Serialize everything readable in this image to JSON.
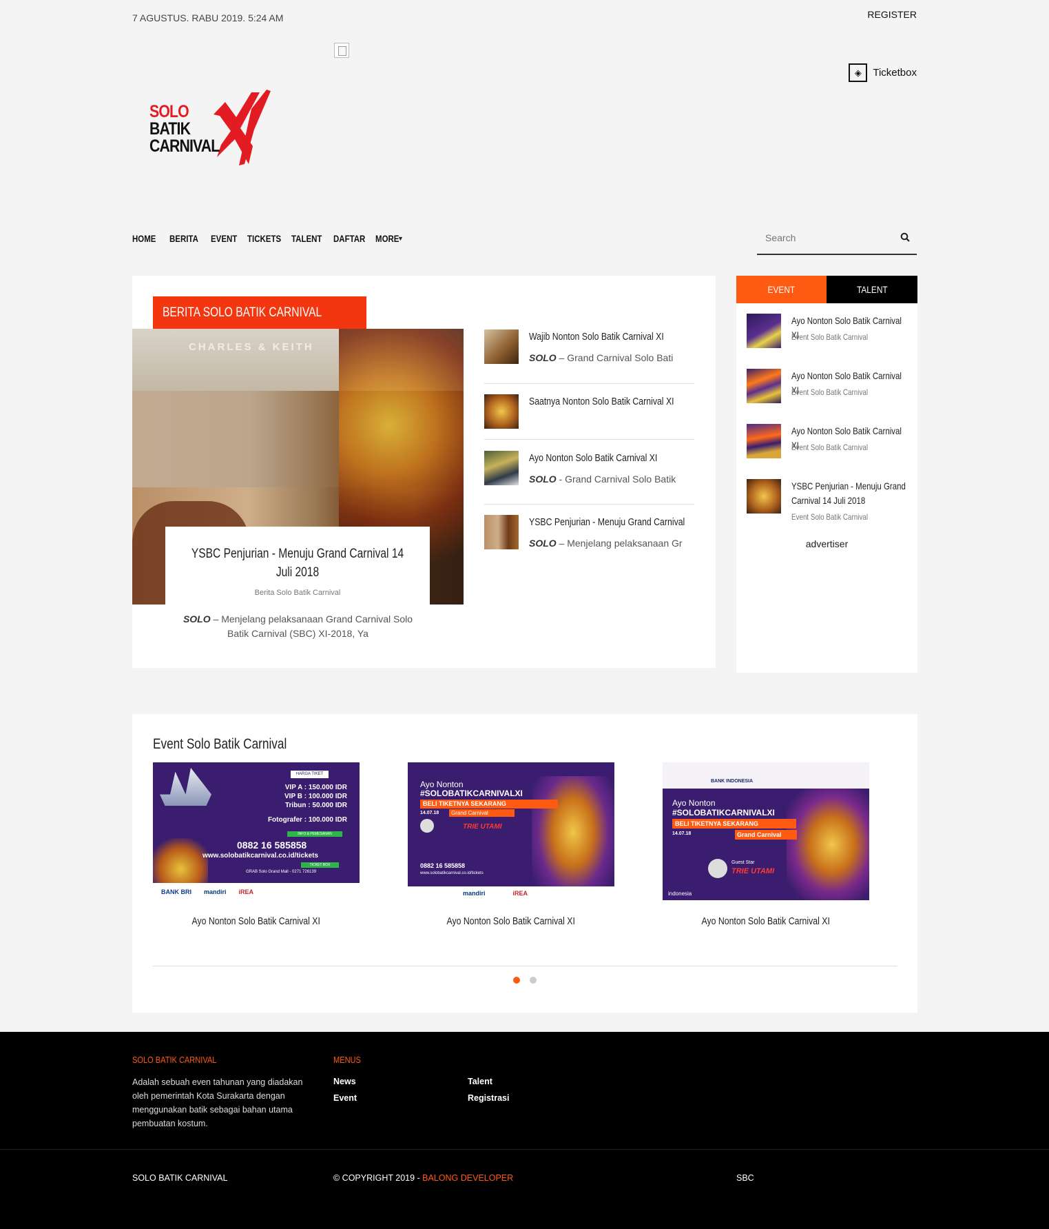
{
  "topbar": {
    "date": "7 AGUSTUS. RABU 2019. 5:24 AM",
    "register": "REGISTER",
    "ticketbox": "Ticketbox"
  },
  "logo": {
    "line1": "SOLO",
    "line2": "BATIK",
    "line3": "CARNIVAL",
    "mark": "XI"
  },
  "nav": {
    "items": [
      "HOME",
      "BERITA",
      "EVENT",
      "TICKETS",
      "TALENT",
      "DAFTAR",
      "MORE"
    ],
    "search_placeholder": "Search"
  },
  "news": {
    "section_tag": "BERITA SOLO BATIK CARNIVAL",
    "featured": {
      "title": "YSBC Penjurian - Menuju Grand Carnival 14 Juli 2018",
      "category": "Berita Solo Batik Carnival",
      "excerpt_lead": "SOLO",
      "excerpt": " – Menjelang pelaksanaan Grand Carnival Solo Batik Carnival (SBC) XI-2018, Ya",
      "image_text": "CHARLES & KEITH"
    },
    "list": [
      {
        "title": "Wajib Nonton Solo Batik Carnival XI",
        "lead": "SOLO",
        "excerpt": " – Grand Carnival Solo Bati"
      },
      {
        "title": "Saatnya Nonton Solo Batik Carnival XI",
        "lead": "",
        "excerpt": ""
      },
      {
        "title": "Ayo Nonton Solo Batik Carnival XI",
        "lead": "SOLO",
        "excerpt": " - Grand Carnival Solo Batik"
      },
      {
        "title": "YSBC Penjurian - Menuju Grand Carnival",
        "lead": "SOLO",
        "excerpt": " – Menjelang pelaksanaan Gr"
      }
    ]
  },
  "sidebar": {
    "tabs": [
      "EVENT",
      "TALENT"
    ],
    "items": [
      {
        "title": "Ayo Nonton Solo Batik Carnival XI",
        "category": "Event Solo Batik Carnival"
      },
      {
        "title": "Ayo Nonton Solo Batik Carnival XI",
        "category": "Event Solo Batik Carnival"
      },
      {
        "title": "Ayo Nonton Solo Batik Carnival XI",
        "category": "Event Solo Batik Carnival"
      },
      {
        "title": "YSBC Penjurian - Menuju Grand Carnival 14 Juli 2018",
        "category": "Event Solo Batik Carnival"
      }
    ],
    "advertiser": "advertiser"
  },
  "events": {
    "heading": "Event Solo Batik Carnival",
    "cards": [
      {
        "caption": "Ayo Nonton Solo Batik Carnival XI",
        "poster_lines": [
          "HARGA TIKET",
          "VIP A : 150.000 IDR",
          "VIP B : 100.000 IDR",
          "Tribun : 50.000 IDR",
          "Fotografer : 100.000 IDR",
          "INFO & PEMESANAN",
          "0882 16 585858",
          "www.solobatikcarnival.co.id/tickets",
          "TICKET BOX",
          "GRAB Solo Grand Mall - 0271 726139",
          "BANK BRI",
          "mandiri",
          "iREA"
        ]
      },
      {
        "caption": "Ayo Nonton Solo Batik Carnival XI",
        "poster_lines": [
          "Ayo Nonton",
          "#SOLOBATIKCARNIVALXI",
          "BELI TIKETNYA SEKARANG",
          "14.07.18",
          "Grand Carnival",
          "TRIE UTAMI",
          "0882 16 585858",
          "www.solobatikcarnival.co.id/tickets",
          "mandiri",
          "iREA"
        ]
      },
      {
        "caption": "Ayo Nonton Solo Batik Carnival XI",
        "poster_lines": [
          "Ayo Nonton",
          "#SOLOBATIKCARNIVALXI",
          "BELI TIKETNYA SEKARANG",
          "14.07.18",
          "Grand Carnival",
          "Guest Star",
          "TRIE UTAMI",
          "BANK INDONESIA",
          "indonesia"
        ]
      }
    ]
  },
  "footer": {
    "about_heading": "SOLO BATIK CARNIVAL",
    "about_text": "Adalah sebuah even tahunan yang diadakan oleh pemerintah Kota Surakarta dengan menggunakan batik sebagai bahan utama pembuatan kostum.",
    "menus_heading": "MENUS",
    "links": [
      "News",
      "Event",
      "Talent",
      "Registrasi"
    ],
    "bottom_left": "SOLO BATIK CARNIVAL",
    "copyright": "© COPYRIGHT 2019 - ",
    "developer": "BALONG DEVELOPER",
    "bottom_right": "SBC"
  },
  "colors": {
    "accent": "#ff5a12",
    "tag_red": "#f3360f",
    "logo_red": "#e31b23",
    "dark": "#000000"
  }
}
